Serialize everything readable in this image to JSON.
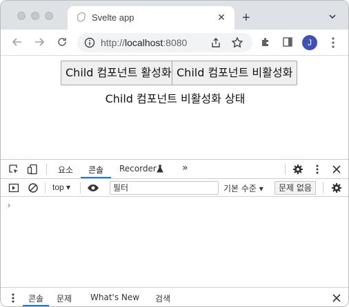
{
  "browser": {
    "tab_title": "Svelte app",
    "url_scheme": "http://",
    "url_host": "localhost",
    "url_port": ":8080",
    "profile_initial": "J",
    "profile_color": "#3f51b5"
  },
  "page": {
    "enable_button_label": "Child 컴포넌트 활성화",
    "disable_button_label": "Child 컴포넌트 비활성화",
    "status_text": "Child 컴포넌트 비활성화 상태"
  },
  "devtools": {
    "tabs": [
      "요소",
      "콘솔",
      "Recorder",
      "»"
    ],
    "active_tab": "콘솔",
    "context": "top",
    "filter_placeholder": "필터",
    "levels_label": "기본 수준",
    "issues_label": "문제 없음",
    "prompt_symbol": "›",
    "drawer_tabs": [
      "콘솔",
      "문제",
      "What's New",
      "검색"
    ],
    "accent_color": "#1a73e8"
  }
}
